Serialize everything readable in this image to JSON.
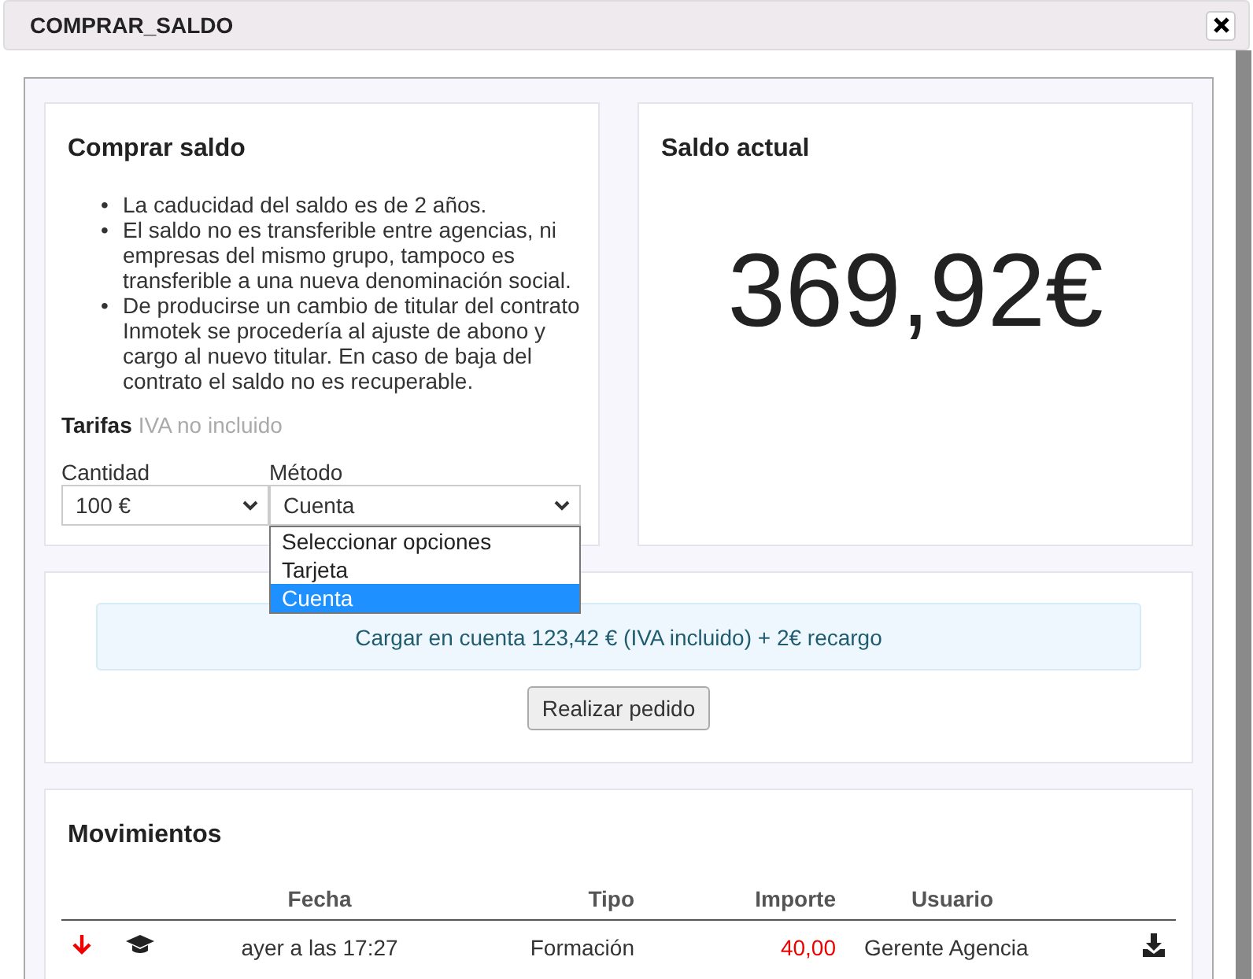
{
  "window": {
    "title": "COMPRAR_SALDO"
  },
  "buy": {
    "heading": "Comprar saldo",
    "notes": [
      {
        "bullet": "•",
        "text": "La caducidad del saldo es de 2 años."
      },
      {
        "bullet": "•",
        "text": "El saldo no es transferible entre agencias, ni empresas del mismo grupo, tampoco es transferible a una nueva denominación social."
      },
      {
        "bullet": "•",
        "text": "De producirse un cambio de titular del contrato Inmotek se procedería al ajuste de abono y cargo al nuevo titular. En caso de baja del contrato el saldo no es recuperable."
      }
    ],
    "rates_label": "Tarifas",
    "rates_note": "IVA no incluido",
    "quantity": {
      "label": "Cantidad",
      "value": "100 €"
    },
    "method": {
      "label": "Método",
      "value": "Cuenta",
      "expanded": true,
      "options": [
        {
          "label": "Seleccionar opciones",
          "selected": false
        },
        {
          "label": "Tarjeta",
          "selected": false
        },
        {
          "label": "Cuenta",
          "selected": true
        }
      ]
    }
  },
  "balance": {
    "heading": "Saldo actual",
    "amount": "369,92€"
  },
  "order": {
    "notice": "Cargar en cuenta 123,42 € (IVA incluido) + 2€ recargo",
    "button": "Realizar pedido"
  },
  "movements": {
    "heading": "Movimientos",
    "columns": [
      "Fecha",
      "Tipo",
      "Importe",
      "Usuario"
    ],
    "rows": [
      {
        "date": "ayer a las 17:27",
        "type": "Formación",
        "amount": "40,00",
        "negative": true,
        "user": "Gerente Agencia"
      }
    ]
  }
}
